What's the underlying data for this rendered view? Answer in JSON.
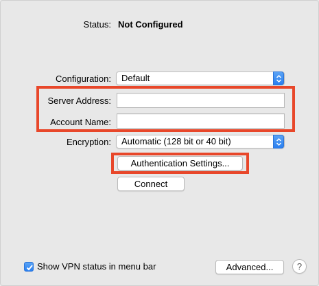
{
  "status": {
    "label": "Status:",
    "value": "Not Configured"
  },
  "configuration": {
    "label": "Configuration:",
    "value": "Default"
  },
  "server_address": {
    "label": "Server Address:",
    "value": ""
  },
  "account_name": {
    "label": "Account Name:",
    "value": ""
  },
  "encryption": {
    "label": "Encryption:",
    "value": "Automatic (128 bit or 40 bit)"
  },
  "buttons": {
    "authentication": "Authentication Settings...",
    "connect": "Connect",
    "advanced": "Advanced...",
    "help": "?"
  },
  "show_status": {
    "label": "Show VPN status in menu bar",
    "checked": true
  },
  "colors": {
    "highlight": "#e8472a",
    "accent": "#2a7ff0"
  },
  "icons": {
    "popup_arrows": "chevron-up-down-icon",
    "checkbox": "checkmark-icon",
    "help": "question-icon"
  }
}
